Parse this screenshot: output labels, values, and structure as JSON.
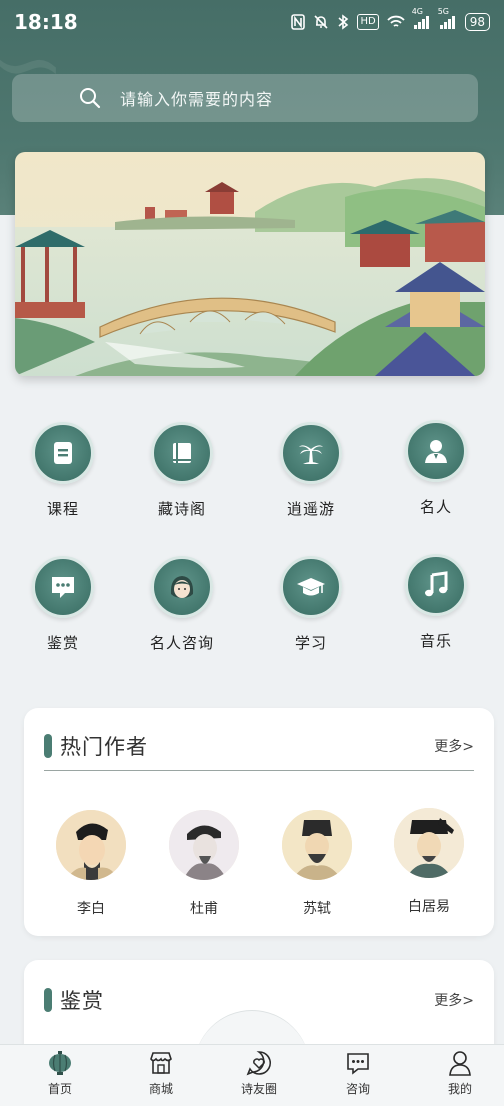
{
  "status_bar": {
    "time": "18:18",
    "network_a": "4G",
    "network_b": "5G",
    "hd": "HD",
    "battery": "98"
  },
  "search": {
    "placeholder": "请输入你需要的内容"
  },
  "categories": [
    {
      "label": "课程",
      "icon": "document-icon"
    },
    {
      "label": "藏诗阁",
      "icon": "book-icon"
    },
    {
      "label": "逍遥游",
      "icon": "palm-tree-icon"
    },
    {
      "label": "名人",
      "icon": "person-icon"
    },
    {
      "label": "鉴赏",
      "icon": "chat-bubble-icon"
    },
    {
      "label": "名人咨询",
      "icon": "woman-face-icon"
    },
    {
      "label": "学习",
      "icon": "graduation-cap-icon"
    },
    {
      "label": "音乐",
      "icon": "music-note-icon"
    }
  ],
  "hot_authors": {
    "title": "热门作者",
    "more": "更多>",
    "authors": [
      {
        "name": "李白"
      },
      {
        "name": "杜甫"
      },
      {
        "name": "苏轼"
      },
      {
        "name": "白居易"
      }
    ]
  },
  "appreciation": {
    "title": "鉴赏",
    "more": "更多>"
  },
  "tabbar": {
    "tabs": [
      {
        "label": "首页",
        "icon": "lantern-icon"
      },
      {
        "label": "商城",
        "icon": "shop-icon"
      },
      {
        "label": "诗友圈",
        "icon": "heart-chat-icon"
      },
      {
        "label": "咨询",
        "icon": "message-icon"
      },
      {
        "label": "我的",
        "icon": "user-icon"
      }
    ]
  },
  "colors": {
    "primary": "#4b7d73",
    "header": "#466e67",
    "background": "#eef1f3"
  }
}
